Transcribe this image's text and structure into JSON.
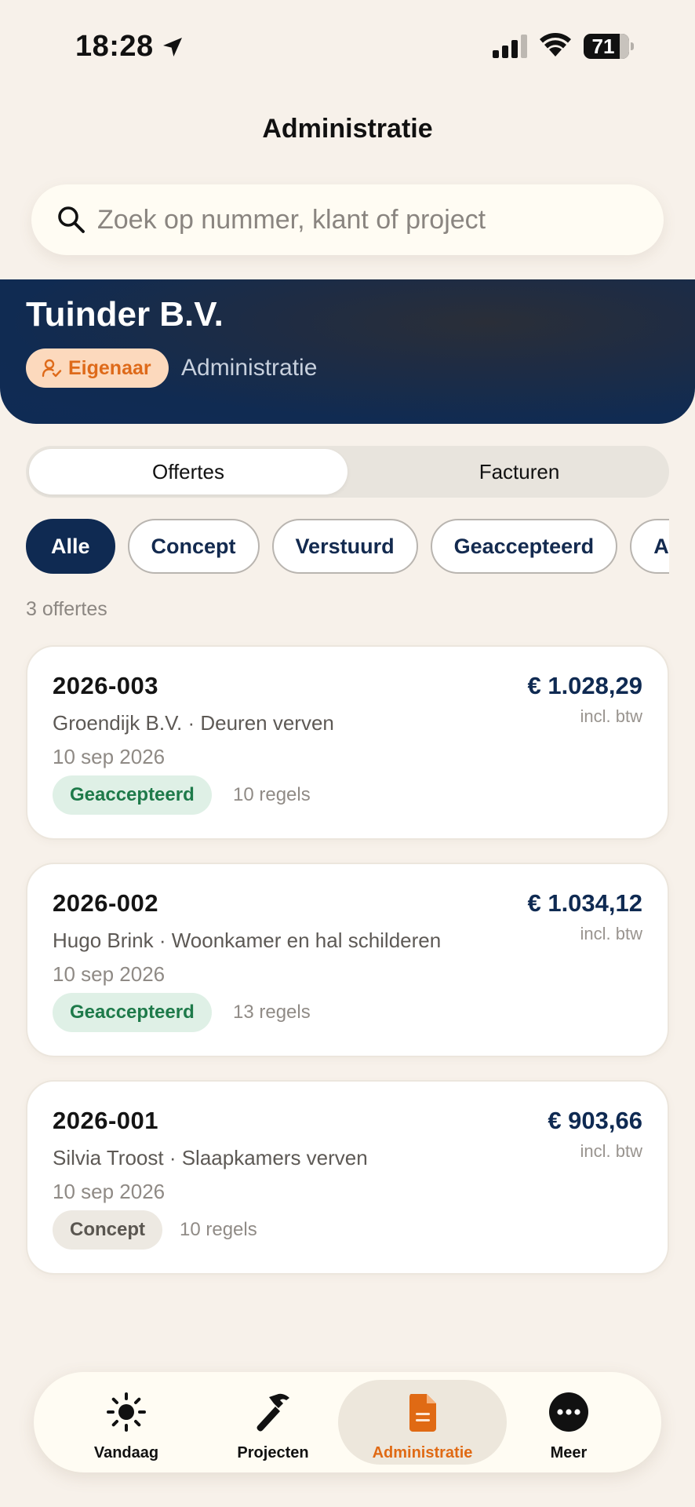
{
  "status_bar": {
    "time": "18:28",
    "battery": "71"
  },
  "header": {
    "title": "Administratie"
  },
  "search": {
    "placeholder": "Zoek op nummer, klant of project"
  },
  "company": {
    "name": "Tuinder B.V.",
    "role": "Eigenaar",
    "section": "Administratie"
  },
  "segments": {
    "offertes": "Offertes",
    "facturen": "Facturen",
    "active": "Offertes"
  },
  "filters": {
    "items": [
      "Alle",
      "Concept",
      "Verstuurd",
      "Geaccepteerd",
      "Afgewezen"
    ],
    "active": "Alle"
  },
  "list": {
    "count": "3 offertes",
    "items": [
      {
        "number": "2026-003",
        "client": "Groendijk B.V. · Deuren verven",
        "date": "10 sep 2026",
        "status": "Geaccepteerd",
        "lines": "10 regels",
        "amount": "€ 1.028,29",
        "vat": "incl. btw"
      },
      {
        "number": "2026-002",
        "client": "Hugo Brink · Woonkamer en hal schilderen",
        "date": "10 sep 2026",
        "status": "Geaccepteerd",
        "lines": "13 regels",
        "amount": "€ 1.034,12",
        "vat": "incl. btw"
      },
      {
        "number": "2026-001",
        "client": "Silvia Troost · Slaapkamers verven",
        "date": "10 sep 2026",
        "status": "Concept",
        "lines": "10 regels",
        "amount": "€ 903,66",
        "vat": "incl. btw"
      }
    ]
  },
  "tabbar": {
    "items": [
      {
        "label": "Vandaag",
        "icon": "sun-icon"
      },
      {
        "label": "Projecten",
        "icon": "hammer-icon"
      },
      {
        "label": "Administratie",
        "icon": "document-icon"
      },
      {
        "label": "Meer",
        "icon": "more-icon"
      }
    ],
    "active": "Administratie"
  },
  "colors": {
    "navy": "#0f2a52",
    "accent_orange": "#e06a14",
    "accepted_green": "#1e7a4a",
    "background": "#f7f1ea"
  }
}
